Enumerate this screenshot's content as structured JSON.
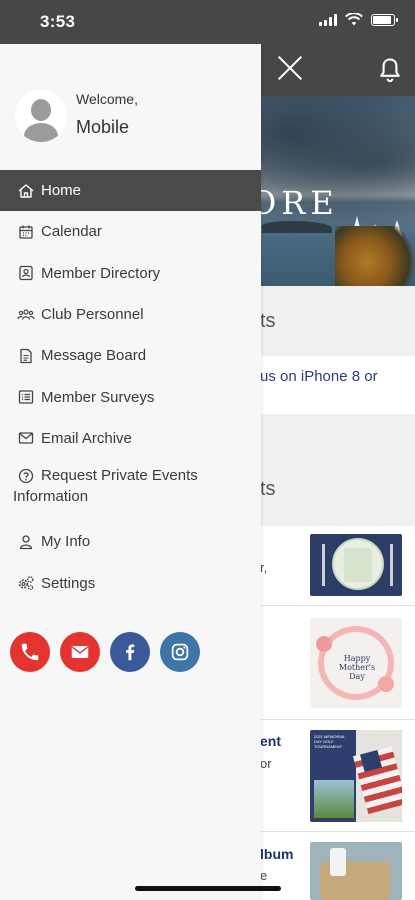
{
  "status_bar": {
    "time": "3:53"
  },
  "drawer": {
    "welcome": "Welcome,",
    "user_name": "Mobile",
    "menu": [
      {
        "label": "Home",
        "icon": "home-icon",
        "active": true
      },
      {
        "label": "Calendar",
        "icon": "calendar-icon"
      },
      {
        "label": "Member Directory",
        "icon": "contact-card-icon"
      },
      {
        "label": "Club Personnel",
        "icon": "people-icon"
      },
      {
        "label": "Message Board",
        "icon": "document-icon"
      },
      {
        "label": "Member Surveys",
        "icon": "list-icon"
      },
      {
        "label": "Email Archive",
        "icon": "envelope-icon"
      },
      {
        "label": "Request Private Events",
        "label2": "Information",
        "icon": "question-icon"
      },
      {
        "label": "My Info",
        "icon": "user-icon"
      },
      {
        "label": "Settings",
        "icon": "gears-icon"
      }
    ],
    "social": [
      {
        "name": "phone",
        "icon": "phone-icon",
        "color": "#e3342f"
      },
      {
        "name": "email",
        "icon": "envelope-icon",
        "color": "#e3342f"
      },
      {
        "name": "facebook",
        "icon": "facebook-icon",
        "color": "#3b5998"
      },
      {
        "name": "instagram",
        "icon": "instagram-icon",
        "color": "#3d75a6"
      }
    ]
  },
  "background": {
    "hero_text": "ORE",
    "section1_fragment": "ts",
    "link_fragment": "us on iPhone 8 or",
    "section2_fragment": "ts",
    "rows": [
      {
        "title": "",
        "sub": "r,",
        "thumb": "place-setting"
      },
      {
        "title": "",
        "sub": "",
        "thumb": "mothers-day-card"
      },
      {
        "title": "ent",
        "sub": "or",
        "thumb": "golf-tournament-flyer"
      },
      {
        "title": "lbum",
        "sub": "e",
        "thumb": "album-photo"
      }
    ],
    "thumb_text": {
      "mothers_day": "Happy Mother's Day",
      "golf": "2021 MEMORIAL DAY GOLF TOURNAMENT"
    }
  },
  "colors": {
    "header": "#474747",
    "accent_link": "#2a3e78",
    "active_menu": "#4a4a4a"
  }
}
